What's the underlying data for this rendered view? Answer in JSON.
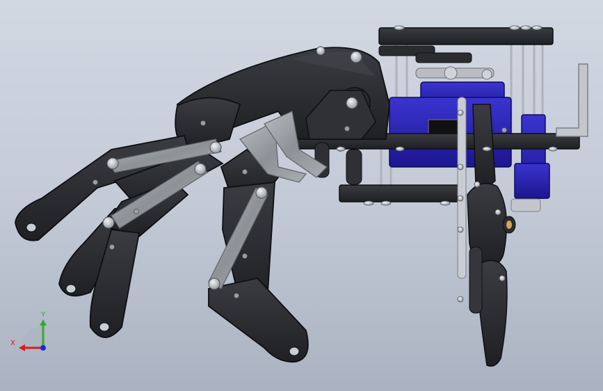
{
  "triad": {
    "x_label": "X",
    "y_label": "Y",
    "x_color": "#d91c1c",
    "y_color": "#2cae2c",
    "z_color": "#1a2ad6"
  },
  "palette": {
    "background_top": "#d2d8e2",
    "background_bottom": "#aab2c1",
    "black_part": "#2b2c30",
    "black_part_edge": "#0e0f12",
    "linkage_metal": "#9b9fa4",
    "servo_blue": "#2a24b4",
    "aluminum": "#c8ccd2",
    "screw": "#cfd3d8"
  },
  "assembly": {
    "parts": [
      {
        "name": "palm-plate"
      },
      {
        "name": "finger-index"
      },
      {
        "name": "finger-middle"
      },
      {
        "name": "finger-ring"
      },
      {
        "name": "finger-little"
      },
      {
        "name": "thumb"
      },
      {
        "name": "servo-bank"
      },
      {
        "name": "servo-horn-pulley"
      },
      {
        "name": "linkage-bars"
      },
      {
        "name": "mounting-bracket"
      }
    ]
  }
}
